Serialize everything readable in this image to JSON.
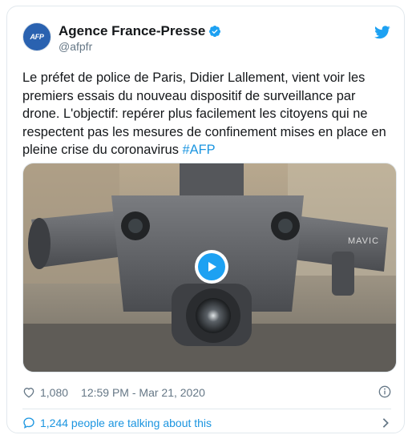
{
  "account": {
    "avatar_text": "AFP",
    "display_name": "Agence France-Presse",
    "handle": "@afpfr"
  },
  "tweet": {
    "text": "Le préfet de police de Paris, Didier Lallement, vient voir les premiers essais du nouveau dispositif de surveillance par drone. L'objectif: repérer plus facilement les citoyens qui ne respectent pas les mesures de confinement mises en place en pleine crise du coronavirus ",
    "hashtag": "#AFP"
  },
  "media": {
    "drone_brand": "MAVIC"
  },
  "meta": {
    "likes": "1,080",
    "timestamp": "12:59 PM - Mar 21, 2020"
  },
  "conversation": {
    "text": "1,244 people are talking about this"
  },
  "colors": {
    "accent": "#1da1f2",
    "link": "#1b95e0",
    "muted": "#657786"
  },
  "icons": [
    "verified-badge-icon",
    "twitter-bird-icon",
    "play-icon",
    "heart-icon",
    "info-icon",
    "comment-bubble-icon",
    "chevron-right-icon"
  ]
}
